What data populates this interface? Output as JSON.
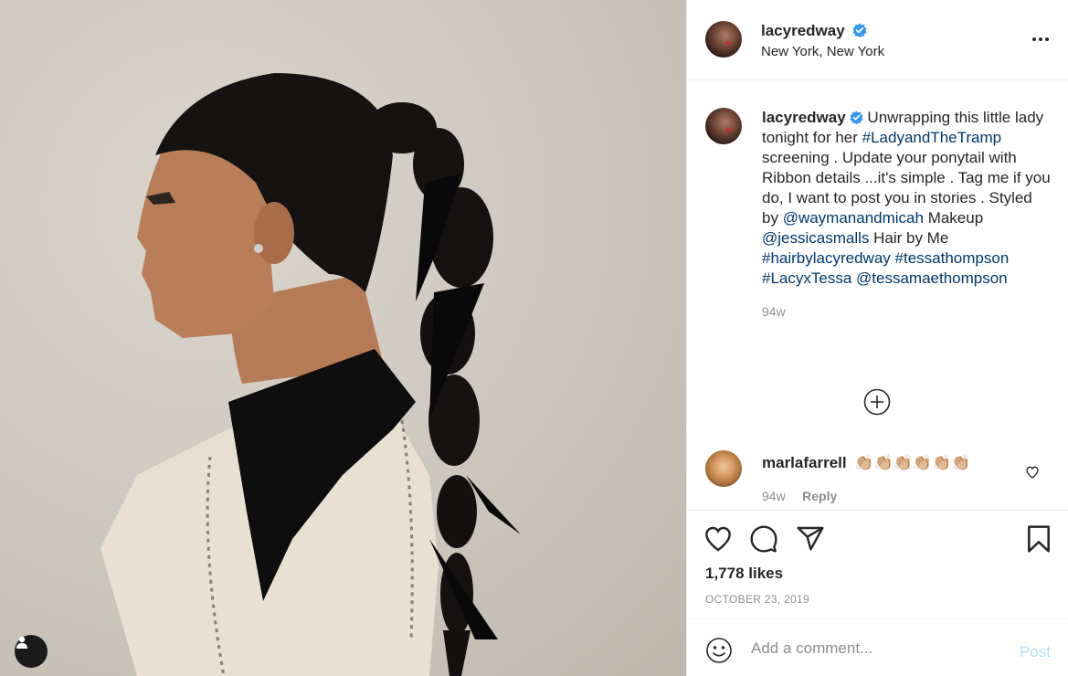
{
  "photo": {
    "alt_description": "",
    "user_tag_icon": "person-icon"
  },
  "header": {
    "username": "lacyredway",
    "location": "New York, New York",
    "verified_icon": "verified-badge-icon",
    "more_icon": "more-options-icon"
  },
  "caption": {
    "username": "lacyredway",
    "segments": [
      {
        "text": " Unwrapping this little lady tonight for her ",
        "type": "text"
      },
      {
        "text": "#LadyandTheTramp",
        "type": "tag"
      },
      {
        "text": " screening . Update your ponytail with Ribbon details ...it's simple . Tag me if you do, I want to post you in stories . Styled by ",
        "type": "text"
      },
      {
        "text": "@waymanandmicah",
        "type": "tag"
      },
      {
        "text": " Makeup ",
        "type": "text"
      },
      {
        "text": "@jessicasmalls",
        "type": "tag"
      },
      {
        "text": " Hair by Me ",
        "type": "text"
      },
      {
        "text": "#hairbylacyredway",
        "type": "tag"
      },
      {
        "text": " ",
        "type": "text"
      },
      {
        "text": "#tessathompson",
        "type": "tag"
      },
      {
        "text": " ",
        "type": "text"
      },
      {
        "text": "#LacyxTessa",
        "type": "tag"
      },
      {
        "text": " ",
        "type": "text"
      },
      {
        "text": "@tessamaethompson",
        "type": "tag"
      }
    ],
    "time": "94w"
  },
  "load_more_icon": "plus-circle-icon",
  "comment": {
    "username": "marlafarrell",
    "text": "👏🏼👏🏼👏🏼👏🏼👏🏼👏🏼",
    "time": "94w",
    "reply_label": "Reply"
  },
  "actions": {
    "like_icon": "heart-icon",
    "comment_icon": "comment-icon",
    "share_icon": "paper-plane-icon",
    "save_icon": "bookmark-icon"
  },
  "likes": "1,778 likes",
  "date": "OCTOBER 23, 2019",
  "comment_box": {
    "placeholder": "Add a comment...",
    "post_label": "Post",
    "emoji_icon": "smiley-icon"
  },
  "colors": {
    "link": "#00376b",
    "verified": "#3897f0",
    "muted": "#8e8e8e",
    "post_disabled": "#b2dffc"
  }
}
